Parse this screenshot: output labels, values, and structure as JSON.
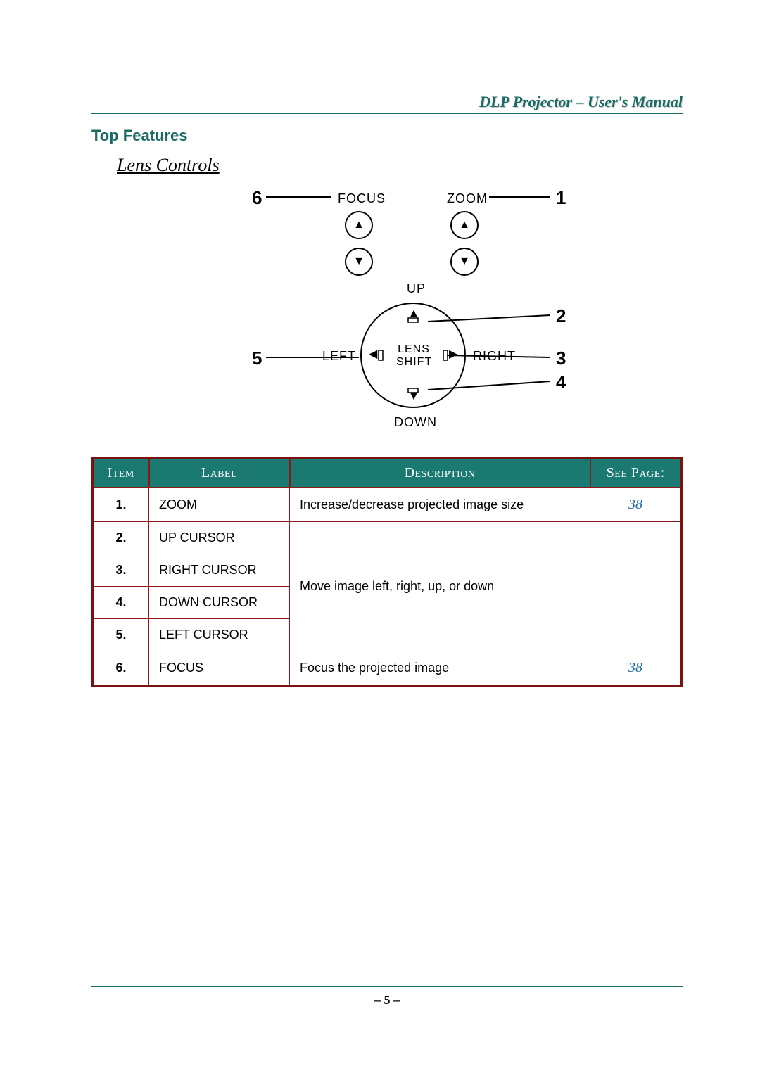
{
  "header": {
    "manual_title": "DLP Projector – User's Manual"
  },
  "section": {
    "title": "Top Features",
    "subsection": "Lens Controls"
  },
  "diagram": {
    "labels": {
      "focus": "FOCUS",
      "zoom": "ZOOM",
      "up": "UP",
      "down": "DOWN",
      "left": "LEFT",
      "right": "RIGHT",
      "lens": "LENS",
      "shift": "SHIFT"
    },
    "callouts": {
      "n1": "1",
      "n2": "2",
      "n3": "3",
      "n4": "4",
      "n5": "5",
      "n6": "6"
    }
  },
  "table": {
    "headers": {
      "item": "Item",
      "label": "Label",
      "description": "Description",
      "see": "See Page:"
    },
    "rows": [
      {
        "item": "1.",
        "label": "ZOOM",
        "description": "Increase/decrease projected image size",
        "see": "38"
      },
      {
        "item": "2.",
        "label": "UP CURSOR"
      },
      {
        "item": "3.",
        "label": "RIGHT CURSOR"
      },
      {
        "item": "4.",
        "label": "DOWN CURSOR"
      },
      {
        "item": "5.",
        "label": "LEFT CURSOR"
      },
      {
        "item": "6.",
        "label": "FOCUS",
        "description": "Focus the projected image",
        "see": "38"
      }
    ],
    "merged_description_2_5": "Move image left, right, up, or down"
  },
  "footer": {
    "page": "– 5 –"
  }
}
